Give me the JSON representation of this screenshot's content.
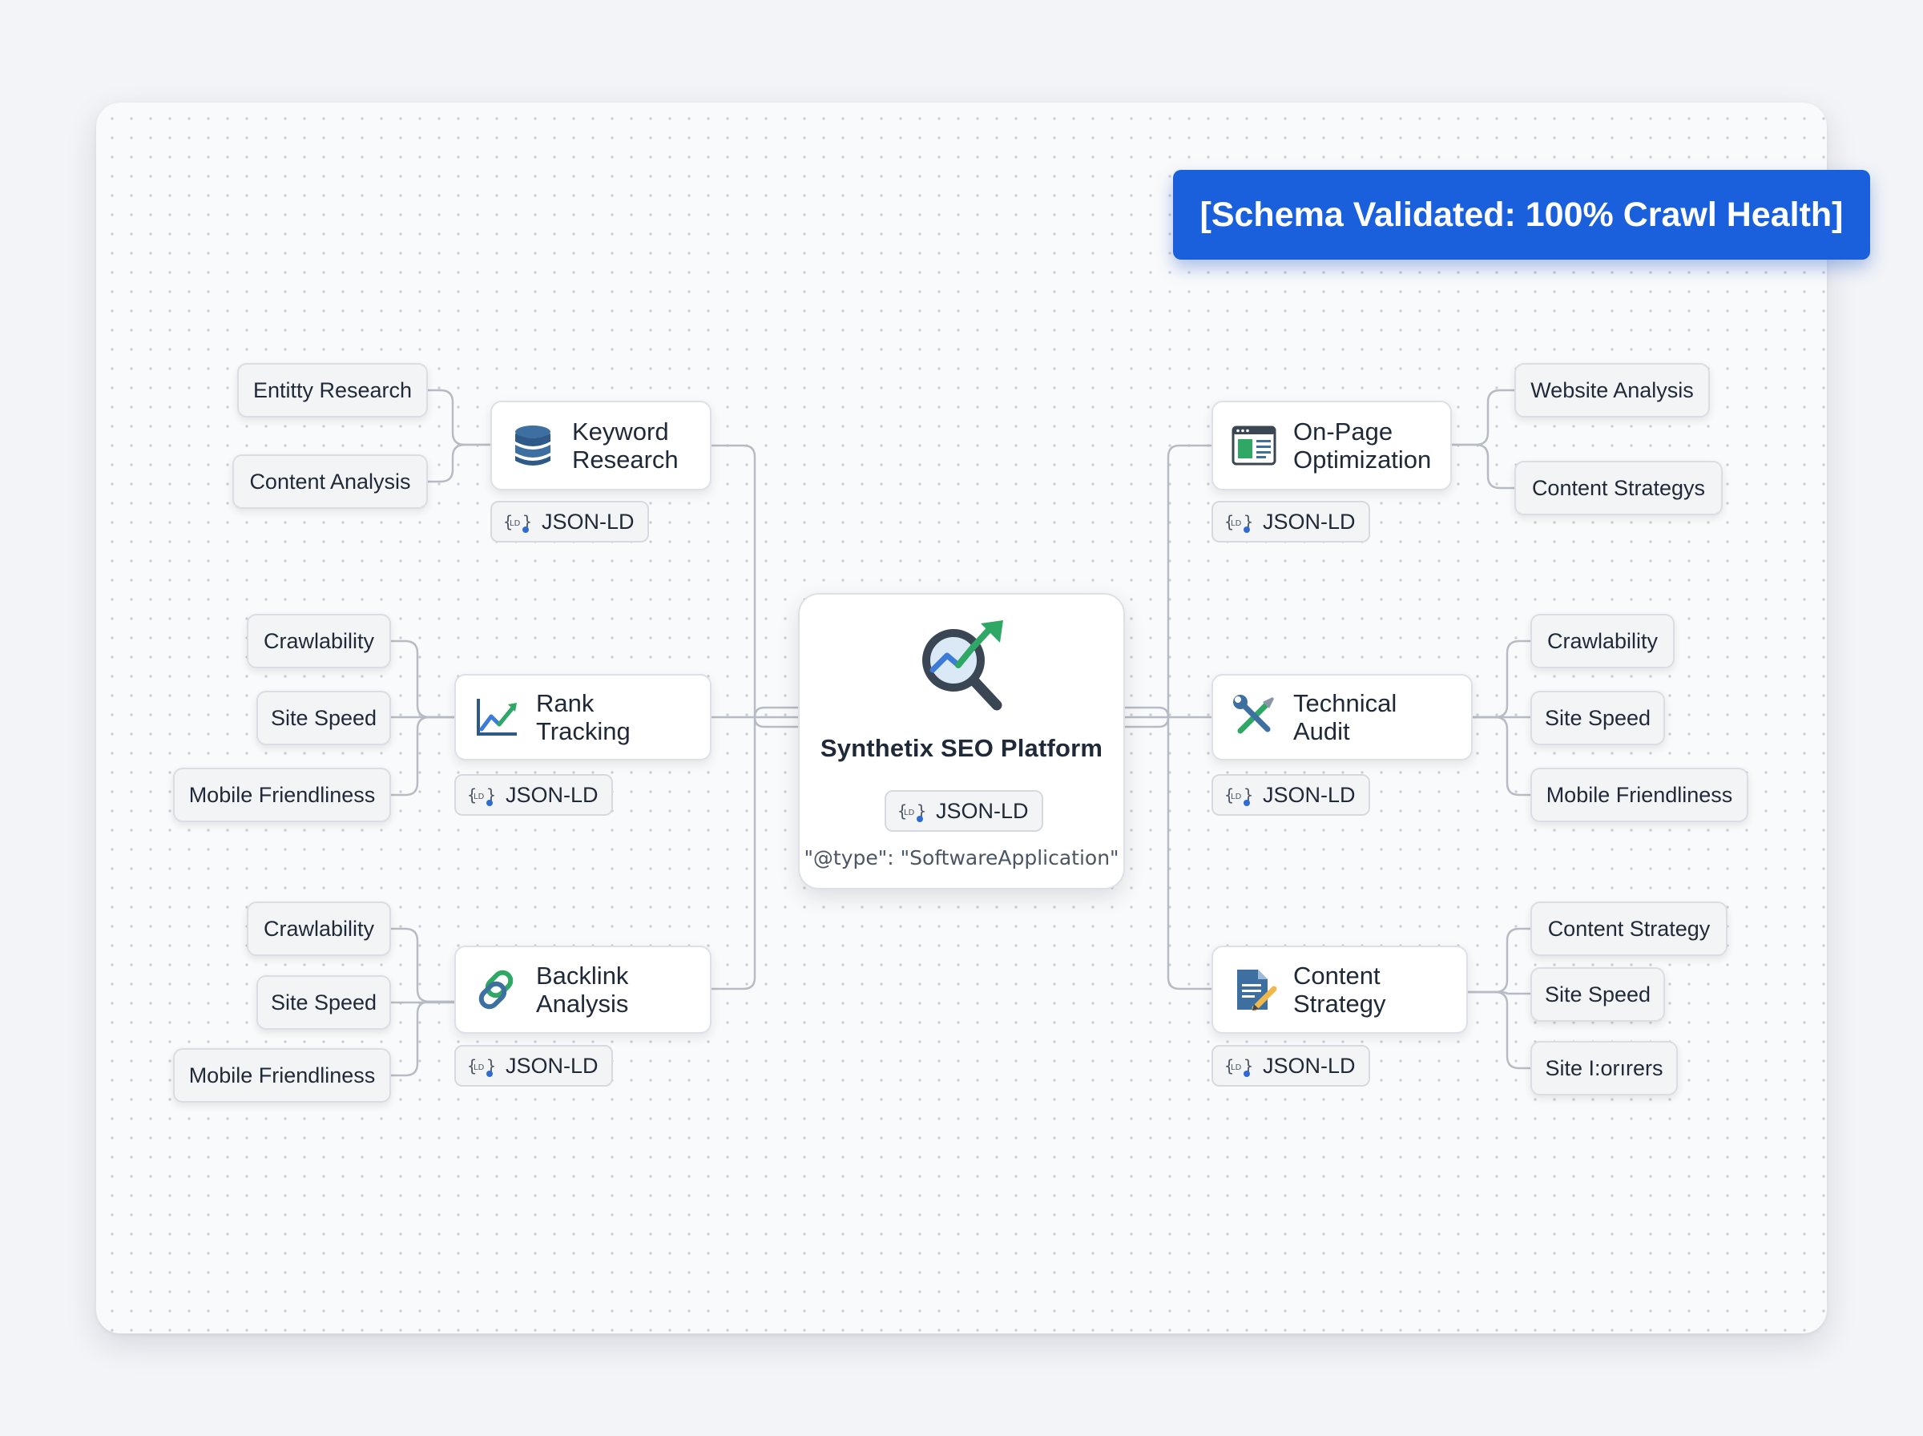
{
  "banner": {
    "text": "[Schema Validated: 100% Crawl Health]",
    "color": "#1a5fdc"
  },
  "center": {
    "title": "Synthetix SEO Platform",
    "badge": "JSON-LD",
    "type_line": "\"@type\": \"SoftwareApplication\"",
    "icon": "magnifier-trending-chart-icon"
  },
  "nodes": {
    "keyword_research": {
      "label_lines": [
        "Keyword",
        "Research"
      ],
      "icon": "database-icon",
      "badge": "JSON-LD",
      "leaves": [
        "Entitty Research",
        "Content Analysis"
      ]
    },
    "rank_tracking": {
      "label_lines": [
        "Rank Tracking"
      ],
      "icon": "line-chart-icon",
      "badge": "JSON-LD",
      "leaves": [
        "Crawlability",
        "Site Speed",
        "Mobile Friendliness"
      ]
    },
    "backlink_analysis": {
      "label_lines": [
        "Backlink",
        "Analysis"
      ],
      "icon": "link-icon",
      "badge": "JSON-LD",
      "leaves": [
        "Crawlability",
        "Site Speed",
        "Mobile Friendliness"
      ]
    },
    "on_page_optimization": {
      "label_lines": [
        "On-Page",
        "Optimization"
      ],
      "icon": "web-page-icon",
      "badge": "JSON-LD",
      "leaves": [
        "Website Analysis",
        "Content Strategys"
      ]
    },
    "technical_audit": {
      "label_lines": [
        "Technical Audit"
      ],
      "icon": "wrench-screwdriver-icon",
      "badge": "JSON-LD",
      "leaves": [
        "Crawlability",
        "Site Speed",
        "Mobile Friendliness"
      ]
    },
    "content_strategy": {
      "label_lines": [
        "Content",
        "Strategy"
      ],
      "icon": "document-pencil-icon",
      "badge": "JSON-LD",
      "leaves": [
        "Content Strategy",
        "Site Speed",
        "Site I:orırers"
      ]
    }
  },
  "colors": {
    "connector": "#b7bcc4",
    "accent_blue": "#1a5fdc",
    "chart_green": "#2fa866",
    "icon_steel": "#3d6fa0"
  }
}
